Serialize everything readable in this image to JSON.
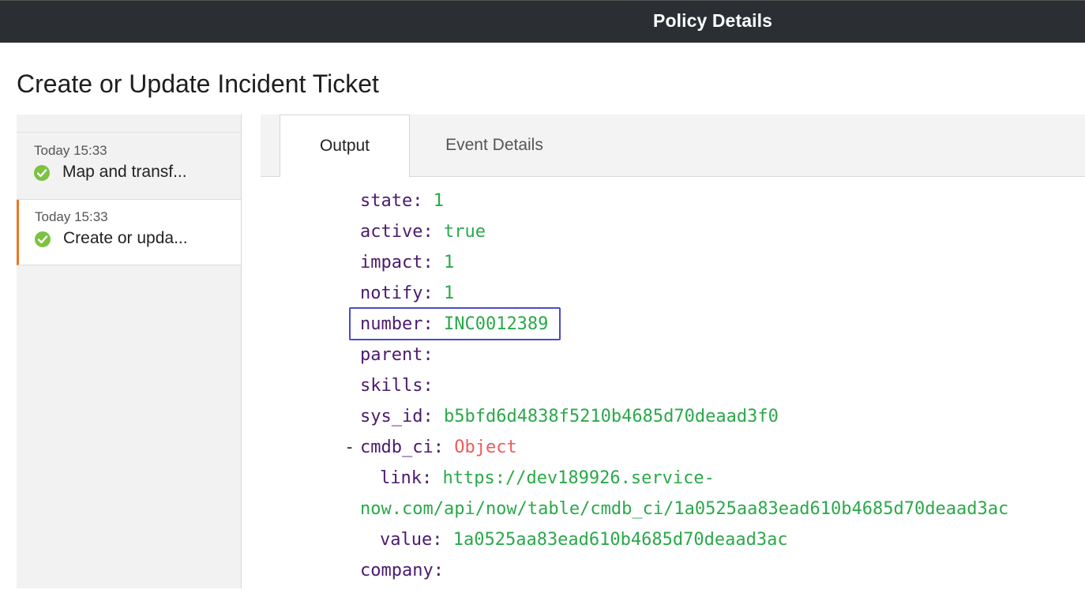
{
  "header": {
    "title": "Policy Details"
  },
  "page": {
    "title": "Create or Update Incident Ticket"
  },
  "sidebar": {
    "runs": [
      {
        "time": "Today 15:33",
        "label": "Map and transf...",
        "status_icon": "success-check-icon"
      },
      {
        "time": "Today 15:33",
        "label": "Create or upda...",
        "status_icon": "success-check-icon",
        "selected": true
      }
    ]
  },
  "tabs": [
    {
      "label": "Output",
      "active": true
    },
    {
      "label": "Event Details",
      "active": false
    }
  ],
  "output": {
    "state": {
      "key": "state:",
      "value": "1"
    },
    "active": {
      "key": "active:",
      "value": "true"
    },
    "impact": {
      "key": "impact:",
      "value": "1"
    },
    "notify": {
      "key": "notify:",
      "value": "1"
    },
    "number": {
      "key": "number:",
      "value": "INC0012389"
    },
    "parent": {
      "key": "parent:",
      "value": ""
    },
    "skills": {
      "key": "skills:",
      "value": ""
    },
    "sys_id": {
      "key": "sys_id:",
      "value": "b5bfd6d4838f5210b4685d70deaad3f0"
    },
    "cmdb_ci": {
      "toggle": "-",
      "key": "cmdb_ci:",
      "value": "Object",
      "link_key": "link:",
      "link_value_line1": "https://dev189926.service-",
      "link_value_line2": "now.com/api/now/table/cmdb_ci/1a0525aa83ead610b4685d70deaad3ac",
      "value_key": "value:",
      "value_value": "1a0525aa83ead610b4685d70deaad3ac"
    },
    "company": {
      "key": "company:",
      "value": ""
    }
  },
  "colors": {
    "topbar": "#2b2f33",
    "key_text": "#4b1a6e",
    "value_text": "#2aa84a",
    "object_text": "#ef5a5a",
    "selected_accent": "#e87722",
    "highlight_box": "#4a4cc8",
    "success": "#7cc242"
  }
}
